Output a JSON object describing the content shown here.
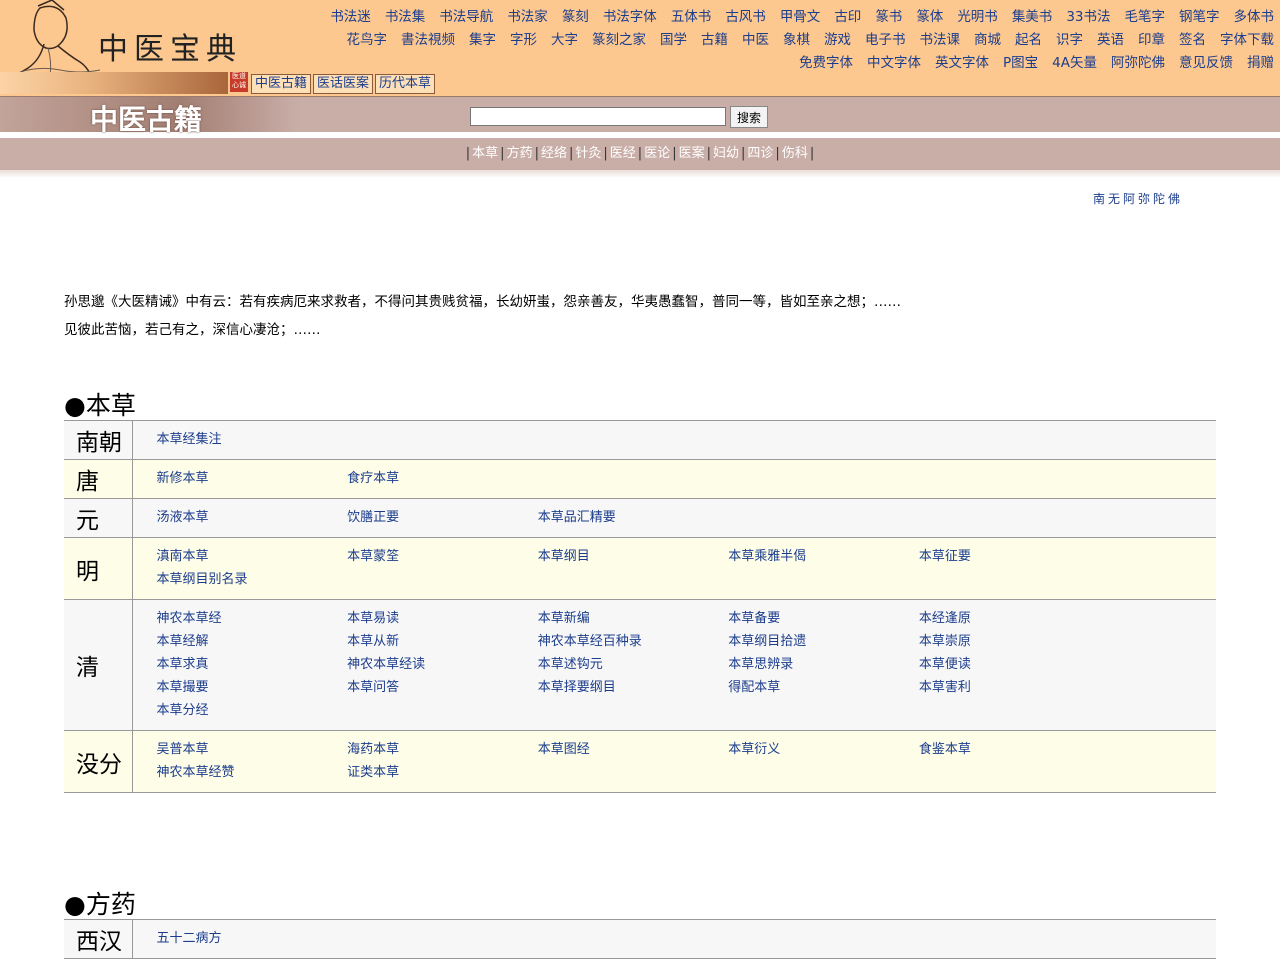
{
  "site": {
    "title": "中医宝典",
    "seal_text": "医道心诚"
  },
  "subtabs": [
    "中医古籍",
    "医话医案",
    "历代本草"
  ],
  "topnav": [
    "书法迷",
    "书法集",
    "书法导航",
    "书法家",
    "篆刻",
    "书法字体",
    "五体书",
    "古风书",
    "甲骨文",
    "古印",
    "篆书",
    "篆体",
    "光明书",
    "集美书",
    "33书法",
    "毛笔字",
    "钢笔字",
    "多体书",
    "花鸟字",
    "書法視频",
    "集字",
    "字形",
    "大字",
    "篆刻之家",
    "国学",
    "古籍",
    "中医",
    "象棋",
    "游戏",
    "电子书",
    "书法课",
    "商城",
    "起名",
    "识字",
    "英语",
    "印章",
    "签名",
    "字体下载",
    "免费字体",
    "中文字体",
    "英文字体",
    "P图宝",
    "4A矢量",
    "阿弥陀佛",
    "意见反馈",
    "捐赠"
  ],
  "page_heading": "中医古籍",
  "search": {
    "placeholder": "",
    "button": "搜索"
  },
  "categories": [
    "本草",
    "方药",
    "经络",
    "针灸",
    "医经",
    "医论",
    "医案",
    "妇幼",
    "四诊",
    "伤科"
  ],
  "namo": "南无阿弥陀佛",
  "quote": [
    "孙思邈《大医精诫》中有云：若有疾病厄来求救者，不得问其贵贱贫福，长幼妍蚩，怨亲善友，华夷愚蠢智，普同一等，皆如至亲之想；……",
    "见彼此苦恼，若己有之，深信心凄沧；……"
  ],
  "sections": [
    {
      "title": "●本草",
      "rows": [
        {
          "dynasty": "南朝",
          "books": [
            "本草经集注"
          ]
        },
        {
          "dynasty": "唐",
          "books": [
            "新修本草",
            "食疗本草"
          ]
        },
        {
          "dynasty": "元",
          "books": [
            "汤液本草",
            "饮膳正要",
            "本草品汇精要"
          ]
        },
        {
          "dynasty": "明",
          "books": [
            "滇南本草",
            "本草蒙筌",
            "本草纲目",
            "本草乘雅半偈",
            "本草征要",
            "本草纲目别名录"
          ]
        },
        {
          "dynasty": "清",
          "books": [
            "神农本草经",
            "本草易读",
            "本草新编",
            "本草备要",
            "本经逢原",
            "本草经解",
            "本草从新",
            "神农本草经百种录",
            "本草纲目拾遗",
            "本草崇原",
            "本草求真",
            "神农本草经读",
            "本草述钩元",
            "本草思辨录",
            "本草便读",
            "本草撮要",
            "本草问答",
            "本草择要纲目",
            "得配本草",
            "本草害利",
            "本草分经"
          ]
        },
        {
          "dynasty": "没分",
          "books": [
            "吴普本草",
            "海药本草",
            "本草图经",
            "本草衍义",
            "食鉴本草",
            "神农本草经赞",
            "证类本草"
          ]
        }
      ]
    },
    {
      "title": "●方药",
      "rows": [
        {
          "dynasty": "西汉",
          "books": [
            "五十二病方"
          ]
        }
      ]
    }
  ]
}
